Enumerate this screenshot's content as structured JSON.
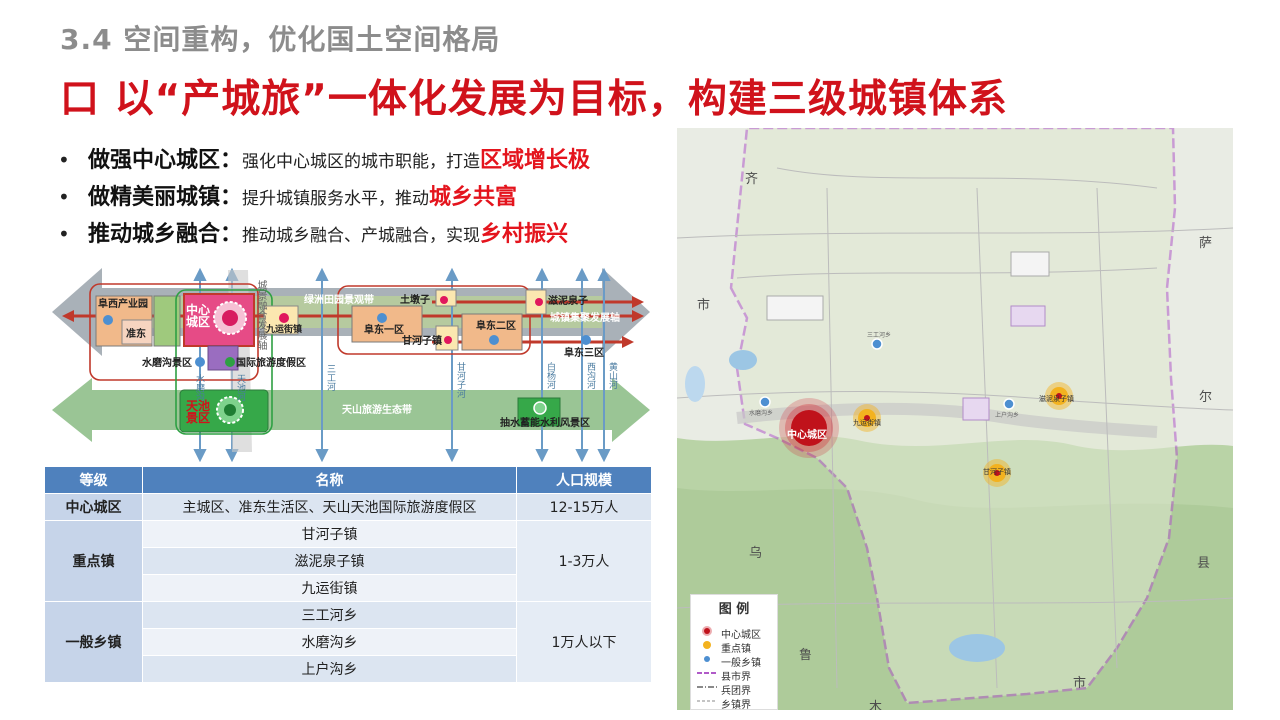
{
  "slide": {
    "subtitle": "3.4 空间重构，优化国土空间格局",
    "headline": "口 以“产城旅”一体化发展为目标，构建三级城镇体系"
  },
  "bullets": [
    {
      "lead": "做强中心城区：",
      "body": "强化中心城区的城市职能，打造",
      "highlight": "区域增长极"
    },
    {
      "lead": "做精美丽城镇：",
      "body": "提升城镇服务水平，推动",
      "highlight": "城乡共富"
    },
    {
      "lead": "推动城乡融合：",
      "body": "推动城乡融合、产城融合，实现",
      "highlight": "乡村振兴"
    }
  ],
  "diagram": {
    "fukang_industrial": "阜西产业园",
    "zhundong": "准东",
    "center_city": "中心城区",
    "jiuyun": "九运街镇",
    "oasis_belt": "绿洲田园景观带",
    "tundunzi": "土墩子",
    "fudong_1": "阜东一区",
    "fudong_2": "阜东二区",
    "ganhezi": "甘河子镇",
    "zinifuanzi": "滋泥泉子",
    "town_axis": "城镇集聚发展轴",
    "fudong_3": "阜东三区",
    "shuimogou": "水磨沟景区",
    "resort": "国际旅游度假区",
    "tianchi": "天池景区",
    "tianshan_belt": "天山旅游生态带",
    "pumped_storage": "抽水蓄能水利风景区",
    "urban_axis": "城景融合发展轴",
    "sanhe": "三工河",
    "ganhe": "甘河子河",
    "baiyang": "白杨河",
    "xigou": "西沟河",
    "huangshan": "黄山河",
    "shuimo_river": "水磨沟",
    "tianchi_river": "天池河"
  },
  "table": {
    "headers": [
      "等级",
      "名称",
      "人口规模"
    ],
    "center": {
      "level": "中心城区",
      "name": "主城区、准东生活区、天山天池国际旅游度假区",
      "pop": "12-15万人"
    },
    "key_towns": {
      "level": "重点镇",
      "names": [
        "甘河子镇",
        "滋泥泉子镇",
        "九运街镇"
      ],
      "pop": "1-3万人"
    },
    "general": {
      "level": "一般乡镇",
      "names": [
        "三工河乡",
        "水磨沟乡",
        "上户沟乡"
      ],
      "pop": "1万人以下"
    }
  },
  "map": {
    "edge_labels": [
      "齐",
      "市",
      "萨",
      "尔",
      "乌",
      "鲁",
      "县",
      "木",
      "市"
    ],
    "center_label": "中心城区",
    "key_towns": [
      "九运街镇",
      "甘河子镇",
      "滋泥泉子镇"
    ],
    "general_towns": [
      "三工河乡",
      "水磨沟乡",
      "上户沟乡"
    ],
    "legend_title": "图 例",
    "legend_items": [
      "中心城区",
      "重点镇",
      "一般乡镇",
      "县市界",
      "兵团界",
      "乡镇界"
    ]
  },
  "colors": {
    "headline": "#d0121b",
    "highlight": "#e4141d",
    "table_header": "#4f81bd",
    "center_city": "#d0303a",
    "key_town": "#f3b21f",
    "general_town": "#4d8fd1"
  }
}
